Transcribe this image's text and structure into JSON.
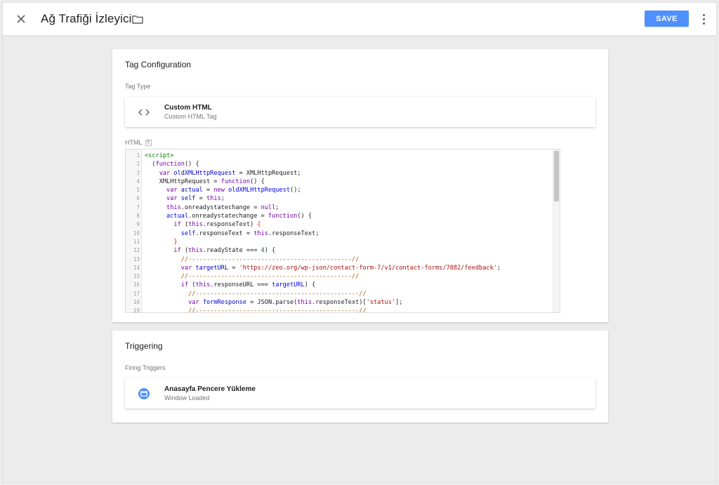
{
  "header": {
    "title": "Ağ Trafiği İzleyici",
    "save_label": "SAVE"
  },
  "tag_config": {
    "title": "Tag Configuration",
    "tag_type_label": "Tag Type",
    "tag_type": {
      "name": "Custom HTML",
      "description": "Custom HTML Tag",
      "icon": "code-brackets-icon"
    },
    "html_label": "HTML",
    "help_label": "?"
  },
  "code_lines": [
    {
      "n": "1",
      "tokens": [
        [
          "tag",
          "<script>"
        ]
      ]
    },
    {
      "n": "2",
      "tokens": [
        [
          "",
          "  ("
        ],
        [
          "kw",
          "function"
        ],
        [
          "",
          "() {"
        ]
      ]
    },
    {
      "n": "3",
      "tokens": [
        [
          "",
          "    "
        ],
        [
          "kw",
          "var"
        ],
        [
          "",
          " "
        ],
        [
          "def",
          "oldXMLHttpRequest"
        ],
        [
          "",
          " = XMLHttpRequest;"
        ]
      ]
    },
    {
      "n": "4",
      "tokens": [
        [
          "",
          "    XMLHttpRequest = "
        ],
        [
          "kw",
          "function"
        ],
        [
          "",
          "() {"
        ]
      ]
    },
    {
      "n": "5",
      "tokens": [
        [
          "",
          "      "
        ],
        [
          "kw",
          "var"
        ],
        [
          "",
          " "
        ],
        [
          "def",
          "actual"
        ],
        [
          "",
          " = "
        ],
        [
          "kw",
          "new"
        ],
        [
          "",
          " "
        ],
        [
          "var",
          "oldXMLHttpRequest"
        ],
        [
          "",
          "();"
        ]
      ]
    },
    {
      "n": "6",
      "tokens": [
        [
          "",
          "      "
        ],
        [
          "kw",
          "var"
        ],
        [
          "",
          " "
        ],
        [
          "def",
          "self"
        ],
        [
          "",
          " = "
        ],
        [
          "kw",
          "this"
        ],
        [
          "",
          ";"
        ]
      ]
    },
    {
      "n": "7",
      "tokens": [
        [
          "",
          "      "
        ],
        [
          "kw",
          "this"
        ],
        [
          "",
          ".onreadystatechange = "
        ],
        [
          "kw",
          "null"
        ],
        [
          "",
          ";"
        ]
      ]
    },
    {
      "n": "8",
      "tokens": [
        [
          "",
          "      "
        ],
        [
          "var",
          "actual"
        ],
        [
          "",
          ".onreadystatechange = "
        ],
        [
          "kw",
          "function"
        ],
        [
          "",
          "() {"
        ]
      ]
    },
    {
      "n": "9",
      "tokens": [
        [
          "",
          "        "
        ],
        [
          "kw",
          "if"
        ],
        [
          "",
          " ("
        ],
        [
          "kw",
          "this"
        ],
        [
          "",
          ".responseText) "
        ],
        [
          "brk",
          "{"
        ]
      ]
    },
    {
      "n": "10",
      "tokens": [
        [
          "",
          "          "
        ],
        [
          "var",
          "self"
        ],
        [
          "",
          ".responseText = "
        ],
        [
          "kw",
          "this"
        ],
        [
          "",
          ".responseText;"
        ]
      ]
    },
    {
      "n": "11",
      "tokens": [
        [
          "",
          "        "
        ],
        [
          "brk",
          "}"
        ]
      ]
    },
    {
      "n": "12",
      "tokens": [
        [
          "",
          "        "
        ],
        [
          "kw",
          "if"
        ],
        [
          "",
          " ("
        ],
        [
          "kw",
          "this"
        ],
        [
          "",
          ".readyState === "
        ],
        [
          "num",
          "4"
        ],
        [
          "",
          ") {"
        ]
      ]
    },
    {
      "n": "13",
      "tokens": [
        [
          "",
          "          "
        ],
        [
          "com",
          "//---------------------------------------------//"
        ]
      ]
    },
    {
      "n": "14",
      "tokens": [
        [
          "",
          "          "
        ],
        [
          "kw",
          "var"
        ],
        [
          "",
          " "
        ],
        [
          "def",
          "targetURL"
        ],
        [
          "",
          " = "
        ],
        [
          "str",
          "'https://zeo.org/wp-json/contact-form-7/v1/contact-forms/7882/feedback'"
        ],
        [
          "",
          ";"
        ]
      ]
    },
    {
      "n": "15",
      "tokens": [
        [
          "",
          "          "
        ],
        [
          "com",
          "//---------------------------------------------//"
        ]
      ]
    },
    {
      "n": "16",
      "tokens": [
        [
          "",
          "          "
        ],
        [
          "kw",
          "if"
        ],
        [
          "",
          " ("
        ],
        [
          "kw",
          "this"
        ],
        [
          "",
          ".responseURL === "
        ],
        [
          "var",
          "targetURL"
        ],
        [
          "",
          ") {"
        ]
      ]
    },
    {
      "n": "17",
      "tokens": [
        [
          "",
          "            "
        ],
        [
          "com",
          "//---------------------------------------------//"
        ]
      ]
    },
    {
      "n": "18",
      "tokens": [
        [
          "",
          "            "
        ],
        [
          "kw",
          "var"
        ],
        [
          "",
          " "
        ],
        [
          "def",
          "formResponse"
        ],
        [
          "",
          " = JSON.parse("
        ],
        [
          "kw",
          "this"
        ],
        [
          "",
          ".responseText)["
        ],
        [
          "str",
          "'status'"
        ],
        [
          "",
          "];"
        ]
      ]
    },
    {
      "n": "19",
      "tokens": [
        [
          "",
          "            "
        ],
        [
          "com",
          "//---------------------------------------------//"
        ]
      ]
    }
  ],
  "triggering": {
    "title": "Triggering",
    "firing_label": "Firing Triggers",
    "trigger": {
      "name": "Anasayfa Pencere Yükleme",
      "type": "Window Loaded",
      "icon": "window-icon",
      "color": "#4d90fe"
    }
  }
}
